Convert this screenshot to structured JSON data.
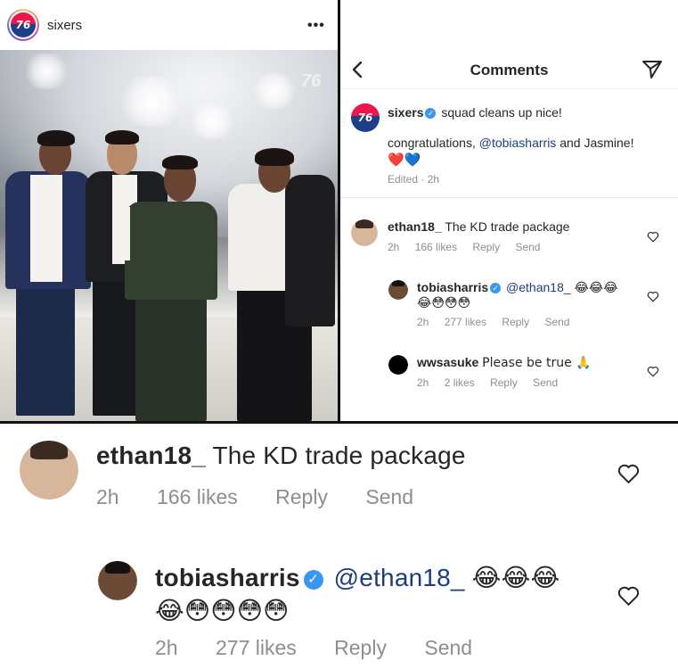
{
  "post": {
    "username": "sixers",
    "more_glyph": "•••",
    "watermark": "76"
  },
  "comments_panel": {
    "title": "Comments",
    "caption": {
      "username": "sixers",
      "text": "squad cleans up nice!",
      "line2_prefix": "congratulations, ",
      "line2_mention": "@tobiasharris",
      "line2_suffix": " and Jasmine!",
      "hearts": [
        "❤️",
        "💙"
      ],
      "meta": "Edited · 2h"
    },
    "comments": [
      {
        "username": "ethan18_",
        "text": "The KD trade package",
        "time": "2h",
        "likes": "166 likes",
        "reply": "Reply",
        "send": "Send"
      },
      {
        "username": "tobiasharris",
        "mention": "@ethan18_",
        "emoji_line1": "😂😂😂",
        "emoji_line2": "😂😳😳😳",
        "time": "2h",
        "likes": "277 likes",
        "reply": "Reply",
        "send": "Send"
      },
      {
        "username": "wwsasuke",
        "text": "Please be true 🙏",
        "time": "2h",
        "likes": "2 likes",
        "reply": "Reply",
        "send": "Send"
      }
    ]
  },
  "zoomed": {
    "comment1": {
      "username": "ethan18_",
      "text": "The KD trade package",
      "time": "2h",
      "likes": "166 likes",
      "reply": "Reply",
      "send": "Send"
    },
    "comment2": {
      "username": "tobiasharris",
      "mention": "@ethan18_",
      "emoji_line1": "😂😂😂",
      "emoji_line2": "😂😳😳😳😳",
      "time": "2h",
      "likes": "277 likes",
      "reply": "Reply",
      "send": "Send"
    }
  },
  "colors": {
    "verified": "#3897f0",
    "mention": "#1a3e7a",
    "meta_gray": "#8e8e8e",
    "divider": "#111111"
  },
  "icons": [
    "sixers-logo-icon",
    "more-icon",
    "back-icon",
    "direct-send-icon",
    "verified-icon",
    "heart-outline-icon",
    "avatar-icon"
  ]
}
